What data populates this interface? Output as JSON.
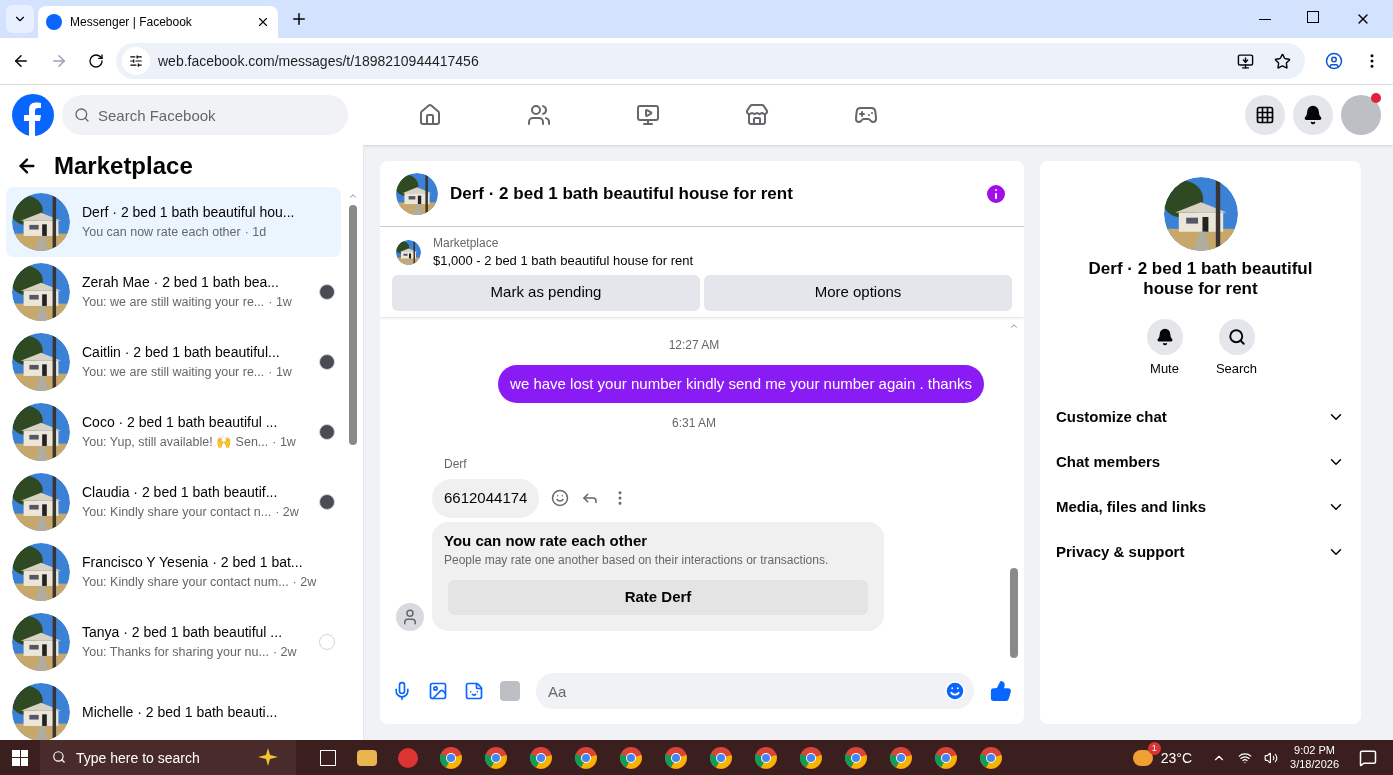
{
  "browser": {
    "tab_title": "Messenger | Facebook",
    "url": "web.facebook.com/messages/t/1898210944417456"
  },
  "facebook_nav": {
    "search_placeholder": "Search Facebook",
    "notification_dot": true
  },
  "sidebar": {
    "title": "Marketplace",
    "conversations": [
      {
        "title": "Derf · 2 bed 1 bath beautiful hou...",
        "preview": "You can now rate each other",
        "time": "· 1d",
        "selected": true
      },
      {
        "title": "Zerah Mae · 2 bed 1 bath bea...",
        "preview": "You: we are still waiting your re...",
        "time": "· 1w",
        "selected": false,
        "kind": "avatar"
      },
      {
        "title": "Caitlin · 2 bed 1 bath beautiful...",
        "preview": "You: we are still waiting your re...",
        "time": "· 1w",
        "selected": false,
        "kind": "avatar"
      },
      {
        "title": "Coco · 2 bed 1 bath beautiful ...",
        "preview": "You: Yup, still available! 🙌 Sen...",
        "time": "· 1w",
        "selected": false,
        "kind": "avatar"
      },
      {
        "title": "Claudia · 2 bed 1 bath beautif...",
        "preview": "You: Kindly share your contact n...",
        "time": "· 2w",
        "selected": false,
        "kind": "avatar"
      },
      {
        "title": "Francisco Y Yesenia · 2 bed 1 bat...",
        "preview": "You: Kindly share your contact num...",
        "time": "· 2w",
        "selected": false
      },
      {
        "title": "Tanya · 2 bed 1 bath beautiful ...",
        "preview": "You: Thanks for sharing your nu...",
        "time": "· 2w",
        "selected": false,
        "kind": "sent"
      },
      {
        "title": "Michelle · 2 bed 1 bath beauti...",
        "selected": false
      }
    ]
  },
  "chat": {
    "title": "Derf · 2 bed 1 bath beautiful house for rent",
    "listing": {
      "label": "Marketplace",
      "text": "$1,000 - 2 bed 1 bath beautiful house for rent",
      "buttons": [
        "Mark as pending",
        "More options"
      ]
    },
    "messages": [
      {
        "kind": "timestamp",
        "text": "12:27 AM"
      },
      {
        "kind": "outgoing",
        "text": "we have lost your number kindly send me your number again . thanks"
      },
      {
        "kind": "timestamp",
        "text": "6:31 AM"
      },
      {
        "kind": "sender",
        "text": "Derf"
      },
      {
        "kind": "incoming",
        "text": "6612044174"
      },
      {
        "kind": "rating",
        "title": "You can now rate each other",
        "text": "People may rate one another based on their interactions or transactions.",
        "button": "Rate Derf"
      }
    ],
    "composer_placeholder": "Aa"
  },
  "info_panel": {
    "title": "Derf · 2 bed 1 bath beautiful house for rent",
    "actions": [
      "Mute",
      "Search"
    ],
    "sections": [
      "Customize chat",
      "Chat members",
      "Media, files and links",
      "Privacy & support"
    ]
  },
  "taskbar": {
    "search_placeholder": "Type here to search",
    "temperature": "23°C",
    "weather_badge": "1",
    "time": "9:02 PM",
    "date": "3/18/2026"
  }
}
